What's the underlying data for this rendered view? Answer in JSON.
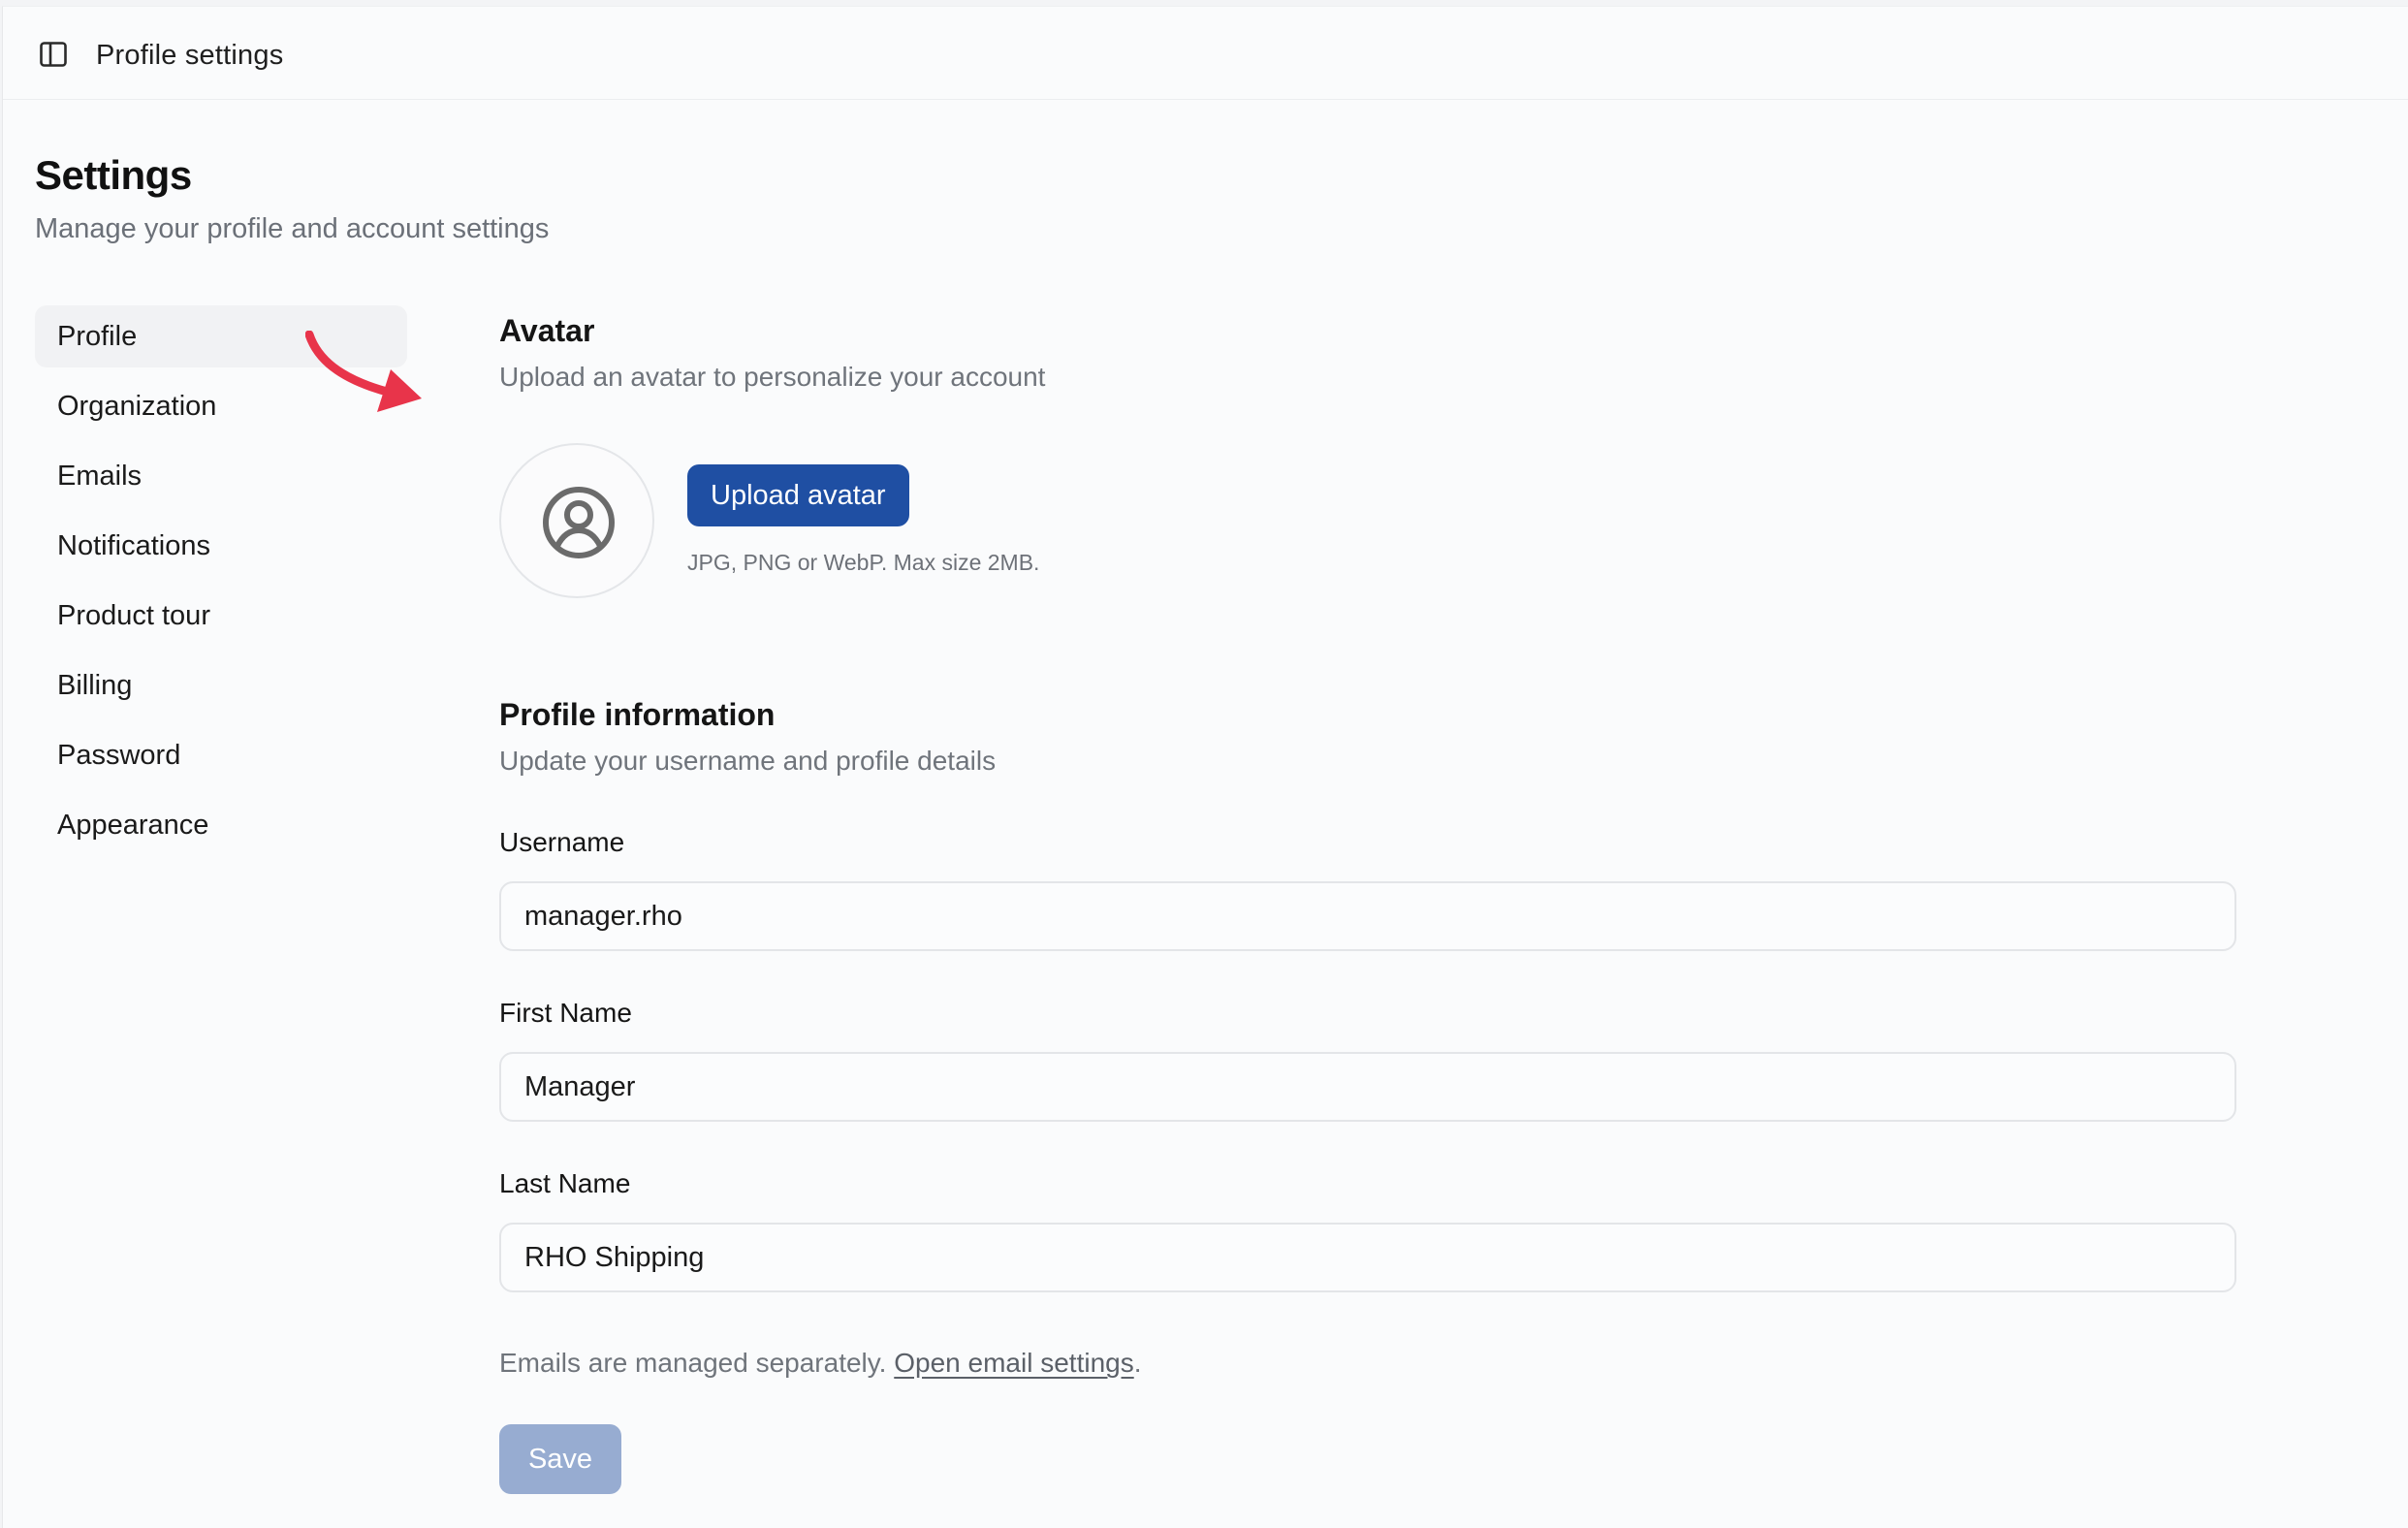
{
  "topbar": {
    "title": "Profile settings",
    "icon": "sidebar-toggle-icon"
  },
  "page": {
    "title": "Settings",
    "subtitle": "Manage your profile and account settings"
  },
  "sidebar": {
    "items": [
      {
        "label": "Profile",
        "active": true
      },
      {
        "label": "Organization",
        "active": false
      },
      {
        "label": "Emails",
        "active": false
      },
      {
        "label": "Notifications",
        "active": false
      },
      {
        "label": "Product tour",
        "active": false
      },
      {
        "label": "Billing",
        "active": false
      },
      {
        "label": "Password",
        "active": false
      },
      {
        "label": "Appearance",
        "active": false
      }
    ]
  },
  "avatar_section": {
    "title": "Avatar",
    "subtitle": "Upload an avatar to personalize your account",
    "upload_label": "Upload avatar",
    "hint": "JPG, PNG or WebP. Max size 2MB.",
    "icon": "user-circle-icon"
  },
  "profile_section": {
    "title": "Profile information",
    "subtitle": "Update your username and profile details",
    "fields": {
      "username": {
        "label": "Username",
        "value": "manager.rho"
      },
      "first_name": {
        "label": "First Name",
        "value": "Manager"
      },
      "last_name": {
        "label": "Last Name",
        "value": "RHO Shipping"
      }
    },
    "email_note_prefix": "Emails are managed separately. ",
    "email_note_link": "Open email settings",
    "email_note_suffix": ".",
    "save_label": "Save"
  },
  "colors": {
    "primary": "#1f4fa3",
    "primary_disabled": "#97acd1",
    "annotation_arrow": "#e8344a",
    "active_nav_bg": "#f1f2f4",
    "page_bg": "#fafbfc"
  }
}
